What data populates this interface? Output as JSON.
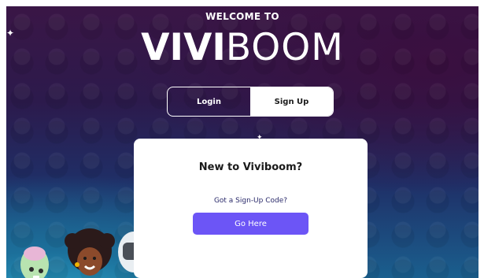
{
  "header": {
    "welcome": "WELCOME TO",
    "logo_bold": "VIVI",
    "logo_thin": "BOOM"
  },
  "auth_toggle": {
    "login_label": "Login",
    "signup_label": "Sign Up",
    "active": "Sign Up"
  },
  "card": {
    "title": "New to Viviboom?",
    "subtitle": "Got a Sign-Up Code?",
    "button_label": "Go Here"
  },
  "colors": {
    "accent": "#6c55f6",
    "bg_top": "#3a1646",
    "bg_bottom": "#1a5f8e"
  },
  "icons": [
    "sparkle-icon",
    "sparkle-icon"
  ]
}
